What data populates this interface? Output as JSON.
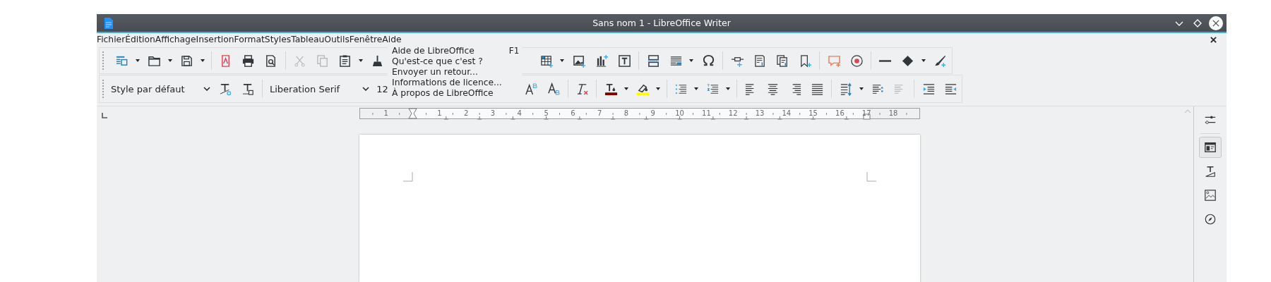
{
  "window": {
    "title": "Sans nom 1 - LibreOffice Writer"
  },
  "menubar": [
    "Fichier",
    "Édition",
    "Affichage",
    "Insertion",
    "Format",
    "Styles",
    "Tableau",
    "Outils",
    "Fenêtre",
    "Aide"
  ],
  "open_menu": {
    "items": [
      {
        "label": "Aide de LibreOffice",
        "shortcut": "F1"
      },
      {
        "label": "Qu'est-ce que c'est ?"
      },
      {
        "label": "Envoyer un retour..."
      },
      {
        "label": "Informations de licence..."
      },
      {
        "label": "À propos de LibreOffice"
      }
    ]
  },
  "formatting": {
    "paragraph_style": "Style par défaut",
    "font_name": "Liberation Serif",
    "font_size": "12"
  },
  "ruler": {
    "labels": [
      "1",
      "1",
      "2",
      "3",
      "4",
      "5",
      "6",
      "7",
      "8",
      "9",
      "10",
      "11",
      "12",
      "13",
      "14",
      "15",
      "16",
      "17",
      "18"
    ]
  },
  "sidebar": {
    "tabs": [
      {
        "kind": "properties",
        "selected": true
      },
      {
        "kind": "styles",
        "selected": false
      },
      {
        "kind": "gallery",
        "selected": false
      },
      {
        "kind": "navigator",
        "selected": false
      }
    ]
  }
}
